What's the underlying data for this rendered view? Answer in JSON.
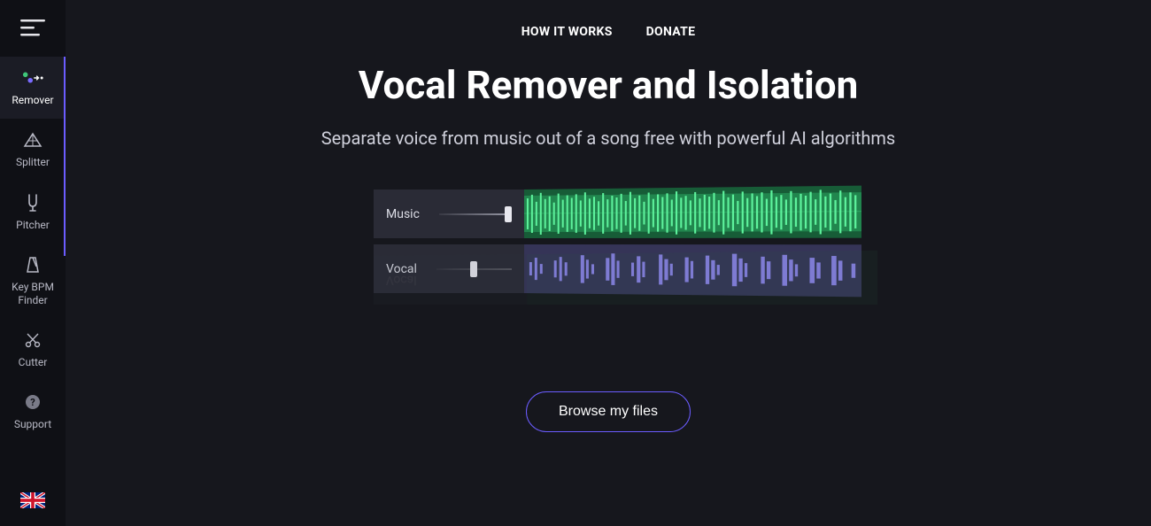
{
  "topnav": {
    "how_it_works": "HOW IT WORKS",
    "donate": "DONATE"
  },
  "hero": {
    "title": "Vocal Remover and Isolation",
    "subtitle": "Separate voice from music out of a song free with powerful AI algorithms"
  },
  "tracks": {
    "music_label": "Music",
    "vocal_label": "Vocal"
  },
  "actions": {
    "browse": "Browse my files"
  },
  "sidebar": {
    "items": [
      {
        "label": "Remover"
      },
      {
        "label": "Splitter"
      },
      {
        "label": "Pitcher"
      },
      {
        "label": "Key BPM Finder"
      },
      {
        "label": "Cutter"
      },
      {
        "label": "Support"
      }
    ]
  }
}
